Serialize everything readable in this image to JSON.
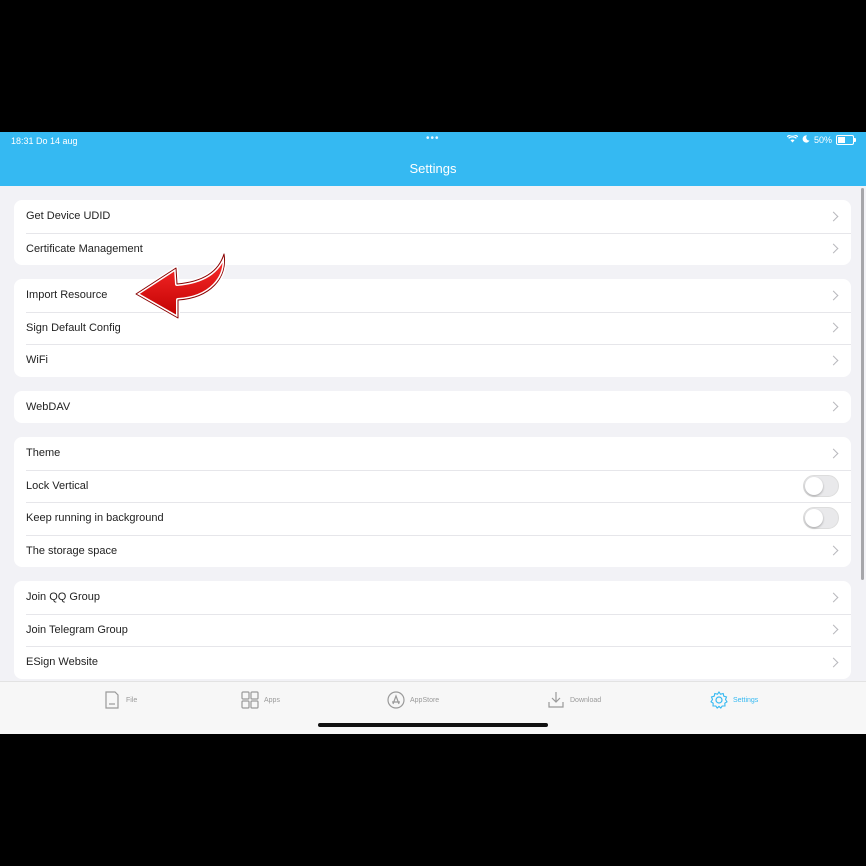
{
  "status": {
    "time": "18:31  Do 14 aug",
    "battery": "50%"
  },
  "header": {
    "title": "Settings"
  },
  "groups": [
    {
      "rows": [
        {
          "label": "Get Device UDID"
        },
        {
          "label": "Certificate Management"
        }
      ]
    },
    {
      "rows": [
        {
          "label": "Import Resource"
        },
        {
          "label": "Sign Default Config"
        },
        {
          "label": "WiFi"
        }
      ]
    },
    {
      "rows": [
        {
          "label": "WebDAV"
        }
      ]
    },
    {
      "rows": [
        {
          "label": "Theme"
        },
        {
          "label": "Lock Vertical",
          "toggle": false
        },
        {
          "label": "Keep running in background",
          "toggle": false
        },
        {
          "label": "The storage space"
        }
      ]
    },
    {
      "rows": [
        {
          "label": "Join QQ Group"
        },
        {
          "label": "Join Telegram Group"
        },
        {
          "label": "ESign Website"
        }
      ]
    }
  ],
  "tabs": {
    "file": "File",
    "apps": "Apps",
    "appstore": "AppStore",
    "download": "Download",
    "settings": "Settings"
  },
  "colors": {
    "accent": "#35b9f2",
    "arrow": "#e01010"
  }
}
